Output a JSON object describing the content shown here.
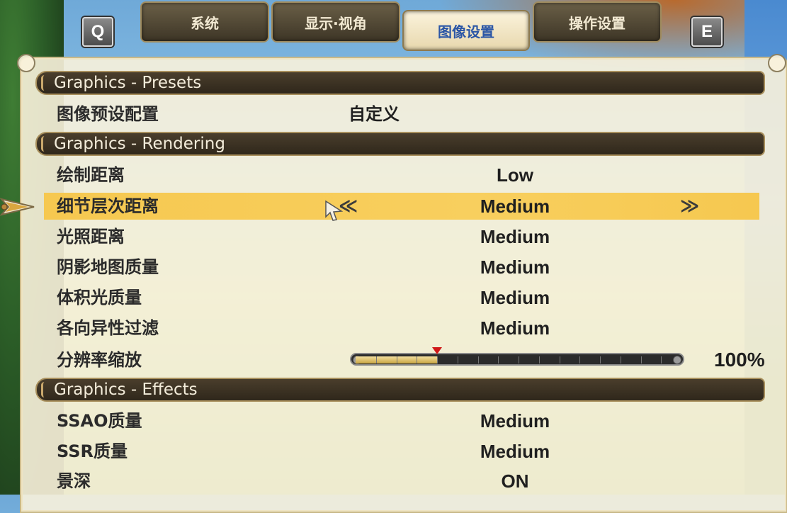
{
  "tabs": {
    "key_left": "Q",
    "key_right": "E",
    "items": [
      {
        "label": "系统"
      },
      {
        "label": "显示·视角"
      },
      {
        "label": "图像设置"
      },
      {
        "label": "操作设置"
      }
    ],
    "active_index": 2
  },
  "sections": {
    "presets": {
      "title": "Graphics - Presets"
    },
    "rendering": {
      "title": "Graphics - Rendering"
    },
    "effects": {
      "title": "Graphics - Effects"
    }
  },
  "rows": {
    "preset": {
      "label": "图像预设配置",
      "value": "自定义"
    },
    "draw_distance": {
      "label": "绘制距离",
      "value": "Low"
    },
    "lod_distance": {
      "label": "细节层次距离",
      "value": "Medium",
      "arrow_left": "≪",
      "arrow_right": "≫"
    },
    "light_distance": {
      "label": "光照距离",
      "value": "Medium"
    },
    "shadow_quality": {
      "label": "阴影地图质量",
      "value": "Medium"
    },
    "volumetric": {
      "label": "体积光质量",
      "value": "Medium"
    },
    "anisotropic": {
      "label": "各向异性过滤",
      "value": "Medium"
    },
    "resolution_scale": {
      "label": "分辨率缩放",
      "value": "100%",
      "fill_fraction": 0.25
    },
    "ssao": {
      "label": "SSAO质量",
      "value": "Medium"
    },
    "ssr": {
      "label": "SSR质量",
      "value": "Medium"
    },
    "dof": {
      "label": "景深",
      "value": "ON"
    }
  },
  "colors": {
    "selected_row": "#f6c850",
    "active_tab_text": "#2b56a6",
    "slider_marker": "#d01818"
  }
}
